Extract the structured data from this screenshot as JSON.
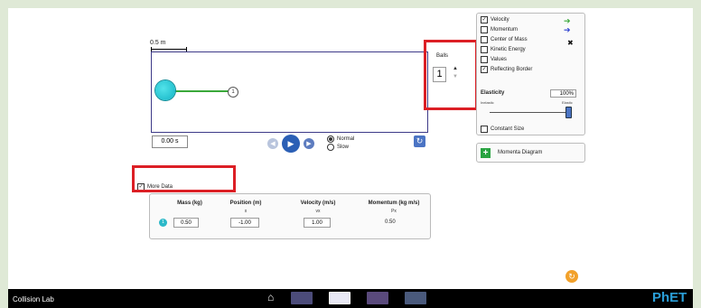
{
  "scale": {
    "label": "0.5 m"
  },
  "simulation": {
    "time": "0.00 s",
    "ball_label": "1"
  },
  "playback": {
    "play_icon": "play-icon",
    "speed_options": [
      {
        "label": "Normal",
        "selected": true
      },
      {
        "label": "Slow",
        "selected": false
      }
    ]
  },
  "balls": {
    "label": "Balls",
    "count": "1"
  },
  "options": [
    {
      "label": "Velocity",
      "checked": true
    },
    {
      "label": "Momentum",
      "checked": false
    },
    {
      "label": "Center of Mass",
      "checked": false
    },
    {
      "label": "Kinetic Energy",
      "checked": false
    },
    {
      "label": "Values",
      "checked": false
    },
    {
      "label": "Reflecting Border",
      "checked": true
    }
  ],
  "elasticity": {
    "label": "Elasticity",
    "value": "100%",
    "left": "Inelastic",
    "right": "Elastic",
    "level": 1.0
  },
  "constant_size": {
    "label": "Constant Size",
    "checked": false
  },
  "momenta_diagram": {
    "label": "Momenta Diagram"
  },
  "more_data": {
    "label": "More Data",
    "checked": true
  },
  "table": {
    "headers": [
      "Mass (kg)",
      "Position (m)",
      "Velocity (m/s)",
      "Momentum (kg m/s)"
    ],
    "subs": [
      "",
      "x",
      "vx",
      "Px"
    ],
    "row": {
      "ball": "1",
      "mass": "0.50",
      "position": "-1.00",
      "velocity": "1.00",
      "momentum": "0.50"
    }
  },
  "navbar": {
    "title": "Collision Lab",
    "brand": "PhET"
  },
  "colors": {
    "highlight": "#dc1f25",
    "velocity": "#3aa83a",
    "momentum": "#2b3fd0"
  }
}
